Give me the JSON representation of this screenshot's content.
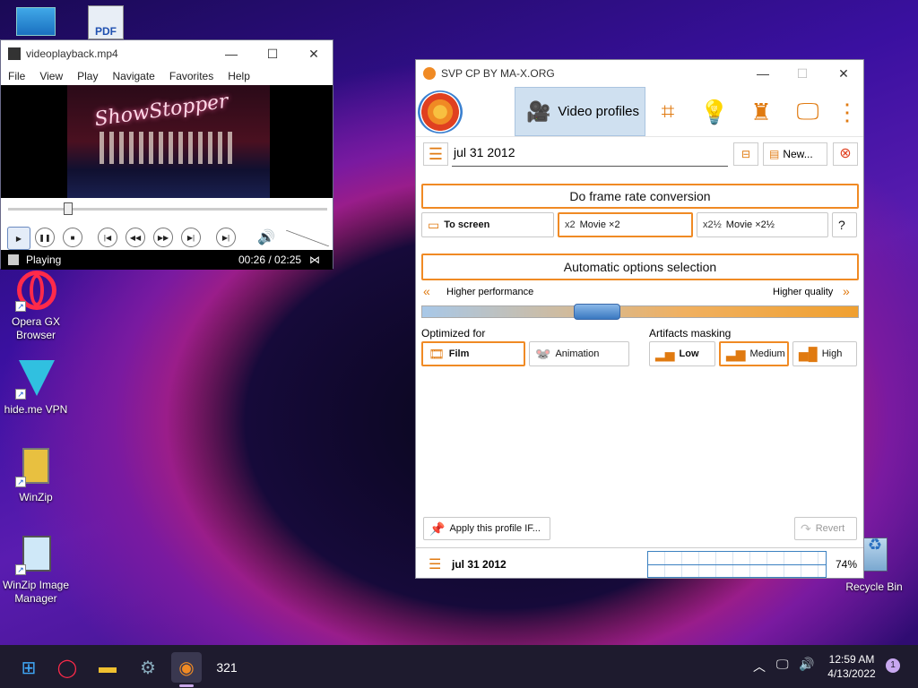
{
  "desktop": {
    "icons": [
      {
        "label": "Opera GX Browser"
      },
      {
        "label": "hide.me VPN"
      },
      {
        "label": "WinZip"
      },
      {
        "label": "WinZip Image Manager"
      },
      {
        "label": "Recycle Bin"
      }
    ],
    "pdf_label": "PDF"
  },
  "mpc": {
    "title": "videoplayback.mp4",
    "menu": [
      "File",
      "View",
      "Play",
      "Navigate",
      "Favorites",
      "Help"
    ],
    "video_text": "ShowStopper",
    "status": "Playing",
    "time": "00:26 / 02:25",
    "progress": 0.18
  },
  "svp": {
    "title": "SVP CP BY MA-X.ORG",
    "tab_label": "Video profiles",
    "profile_name": "jul 31 2012",
    "new_label": "New...",
    "frame_rate_label": "Do frame rate conversion",
    "modes": [
      {
        "label": "To screen"
      },
      {
        "label": "Movie ×2",
        "prefix": "x2"
      },
      {
        "label": "Movie ×2½",
        "prefix": "x2½"
      }
    ],
    "help_label": "?",
    "auto_label": "Automatic options selection",
    "perf_label": "Higher performance",
    "quality_label": "Higher quality",
    "slider_value": 0.39,
    "optimized_label": "Optimized for",
    "film_label": "Film",
    "animation_label": "Animation",
    "artifacts_label": "Artifacts masking",
    "low_label": "Low",
    "medium_label": "Medium",
    "high_label": "High",
    "apply_label": "Apply this profile IF...",
    "revert_label": "Revert",
    "footer_profile": "jul 31 2012",
    "cpu": "74%"
  },
  "taskbar": {
    "time": "12:59 AM",
    "date": "4/13/2022",
    "notif": "1"
  },
  "colors": {
    "accent": "#f08a24",
    "slider_blue": "#5a9ad8"
  }
}
